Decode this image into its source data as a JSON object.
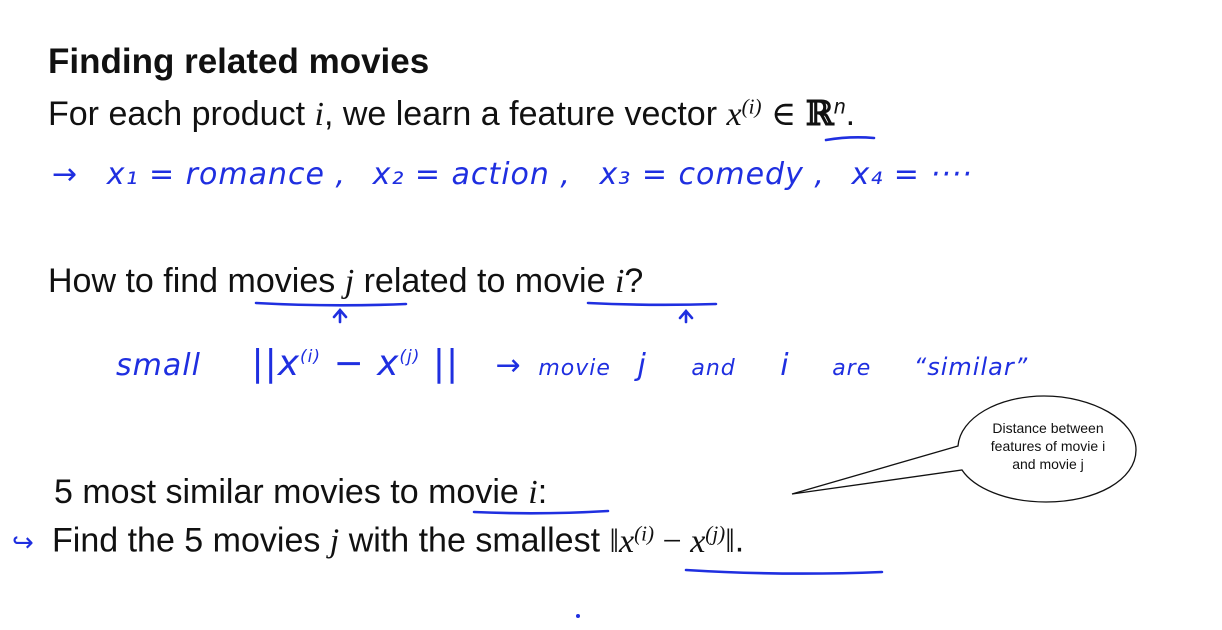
{
  "slide": {
    "title": "Finding related movies",
    "line1": {
      "prefix": "For each product ",
      "var_i": "i",
      "middle": ", we learn a feature vector ",
      "x": "x",
      "sup": "(i)",
      "in_sym": "∈",
      "real": "ℝ",
      "n": "n",
      "suffix": "."
    },
    "note1": {
      "arrow": "→",
      "x1": "x₁ = romance ,",
      "x2": "x₂ = action ,",
      "x3": "x₃ = comedy ,",
      "x4": "x₄ = ····"
    },
    "line2": {
      "prefix": "How to find ",
      "movies": "movies",
      "var_j": "j",
      "middle": " related to ",
      "movie": "movie",
      "var_i": "i",
      "suffix": "?"
    },
    "note2": {
      "small": "small",
      "norm_open": "||x",
      "sup_i": "(i)",
      "minus": "− x",
      "sup_j": "(j)",
      "norm_close": "||",
      "arrow": "→",
      "movie": "movie",
      "j": "j",
      "and": "and",
      "i": "i",
      "are": "are",
      "similar": "“similar”"
    },
    "line3": {
      "prefix": "5 most similar movies to ",
      "movie": "movie",
      "var_i": "i",
      "suffix": ":"
    },
    "line4": {
      "arrow": "↪",
      "prefix": "Find the 5 movies ",
      "var_j": "j",
      "middle": " with the smallest ",
      "norm_l": "‖",
      "x1": "x",
      "sup_i": "(i)",
      "minus": " − ",
      "x2": "x",
      "sup_j": "(j)",
      "norm_r": "‖",
      "suffix": "."
    },
    "callout": {
      "line1": "Distance between",
      "line2": "features of movie i",
      "line3": "and movie j"
    }
  },
  "colors": {
    "ink": "#1f2fe0",
    "text": "#111111",
    "background": "#ffffff"
  }
}
